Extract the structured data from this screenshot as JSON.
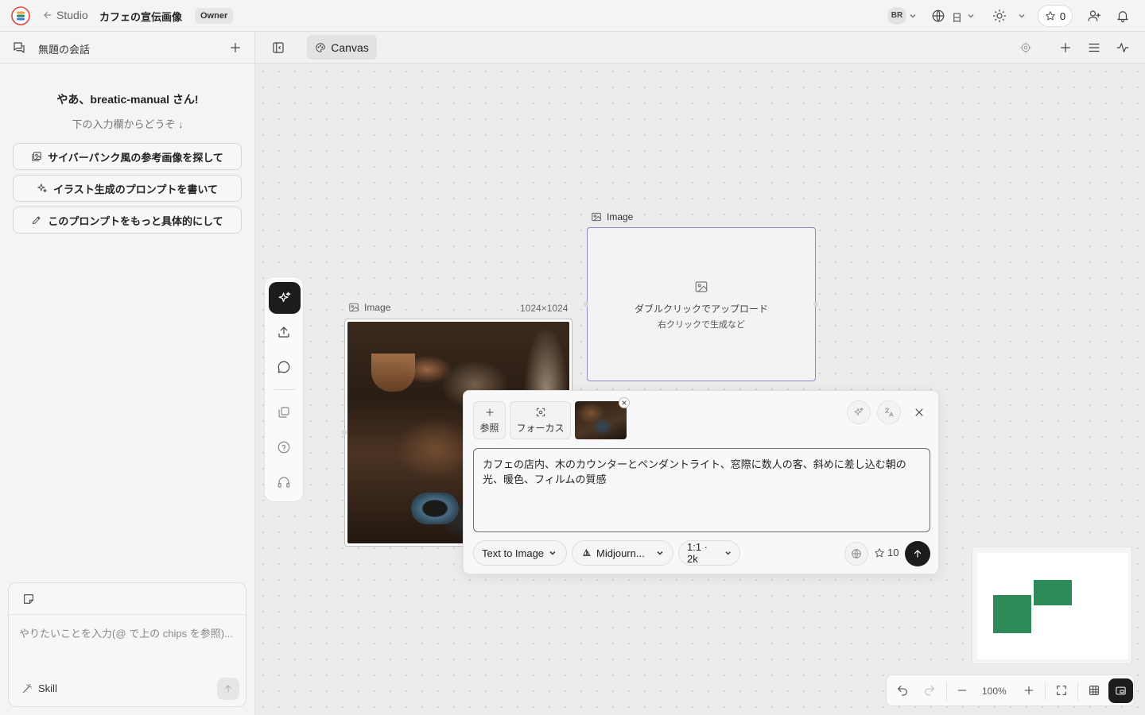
{
  "header": {
    "back_label": "Studio",
    "project_title": "カフェの宣伝画像",
    "role_badge": "Owner",
    "avatar_initials": "BR",
    "language": "日",
    "credits": "0"
  },
  "sidebar": {
    "conversation_title": "無題の会話",
    "greeting": "やあ、breatic-manual さん!",
    "greeting_sub": "下の入力欄からどうぞ ↓",
    "suggestions": [
      {
        "label": "サイバーパンク風の参考画像を探して",
        "icon": "image-search-icon"
      },
      {
        "label": "イラスト生成のプロンプトを書いて",
        "icon": "sparkles-icon"
      },
      {
        "label": "このプロンプトをもっと具体的にして",
        "icon": "pencil-icon"
      }
    ],
    "chat_placeholder": "やりたいことを入力(@ で上の chips を参照)...",
    "skill_label": "Skill"
  },
  "canvas": {
    "tab_label": "Canvas",
    "image_node": {
      "label": "Image",
      "size": "1024×1024"
    },
    "upload_node": {
      "label": "Image",
      "line1": "ダブルクリックでアップロード",
      "line2": "右クリックで生成など"
    },
    "zoom": "100%"
  },
  "generator": {
    "ref_label": "参照",
    "focus_label": "フォーカス",
    "prompt": "カフェの店内、木のカウンターとペンダントライト、窓際に数人の客、斜めに差し込む朝の光、暖色、フィルムの質感",
    "mode": "Text to Image",
    "model": "Midjourn...",
    "ratio": "1:1 · 2k",
    "cost": "10"
  },
  "colors": {
    "accent_dark": "#1c1c1c",
    "selection_border": "#8b86d6",
    "minimap_node": "#2f8a5a"
  }
}
